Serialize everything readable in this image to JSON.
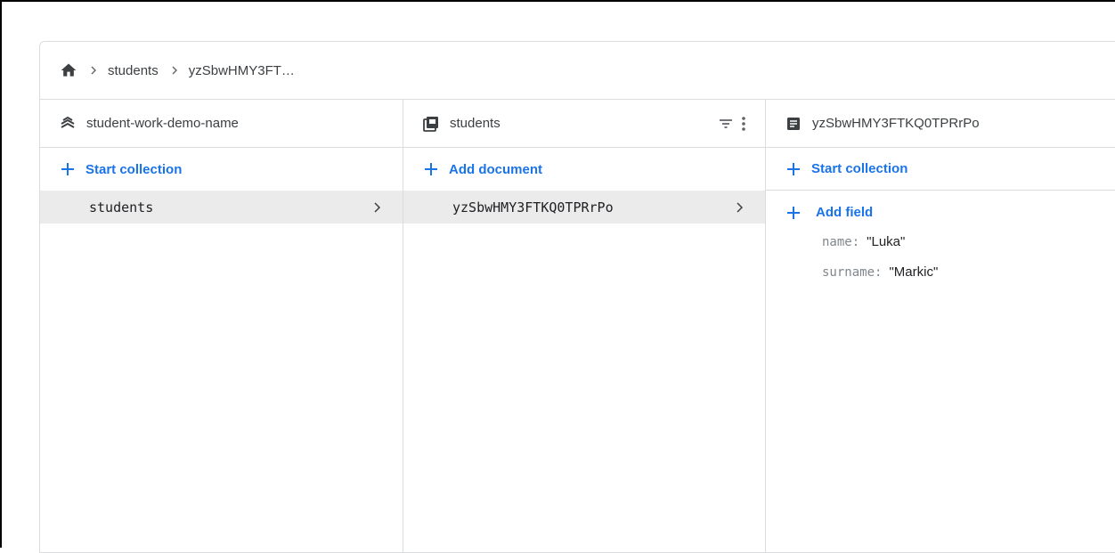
{
  "breadcrumb": {
    "icon": "home-icon",
    "items": [
      "students",
      "yzSbwHMY3FT…"
    ]
  },
  "columns": {
    "project": {
      "icon": "firestore-icon",
      "title": "student-work-demo-name",
      "action_label": "Start collection",
      "items": [
        {
          "label": "students"
        }
      ]
    },
    "collection": {
      "icon": "collection-icon",
      "title": "students",
      "action_label": "Add document",
      "items": [
        {
          "label": "yzSbwHMY3FTKQ0TPRrPo"
        }
      ]
    },
    "document": {
      "icon": "document-icon",
      "title": "yzSbwHMY3FTKQ0TPRrPo",
      "start_collection_label": "Start collection",
      "add_field_label": "Add field",
      "fields": [
        {
          "key": "name",
          "value": "\"Luka\""
        },
        {
          "key": "surname",
          "value": "\"Markic\""
        }
      ]
    }
  },
  "colors": {
    "accent": "#1a73e8",
    "selected_bg": "#ebebeb",
    "border": "#dadce0"
  }
}
